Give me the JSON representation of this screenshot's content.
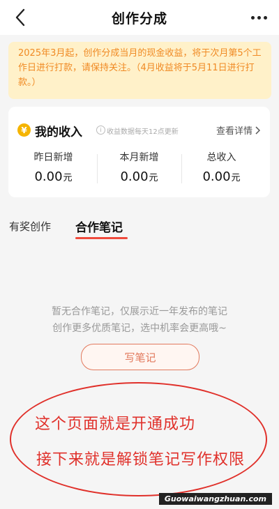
{
  "header": {
    "title": "创作分成",
    "back_icon": "chevron-left-icon",
    "more_icon": "more-horizontal-icon"
  },
  "notice": {
    "text": "2025年3月起，创作分成当月的现金收益，将于次月第5个工作日进行打款，请保持关注。（4月收益将于5月11日进行打款。）",
    "background": "#fff1c9",
    "color": "#f08a24"
  },
  "income": {
    "coin_symbol": "¥",
    "title": "我的收入",
    "info_icon": "info-icon",
    "subtitle": "收益数据每天12点更新",
    "detail_link": "查看详情",
    "stats": [
      {
        "label": "昨日新增",
        "value": "0.00",
        "unit": "元"
      },
      {
        "label": "本月新增",
        "value": "0.00",
        "unit": "元"
      },
      {
        "label": "总收入",
        "value": "0.00",
        "unit": "元"
      }
    ]
  },
  "tabs": {
    "items": [
      "有奖创作",
      "合作笔记"
    ],
    "active_index": 1,
    "accent": "#ef4a3c"
  },
  "empty_state": {
    "line1": "暂无合作笔记，仅展示近一年发布的笔记",
    "line2": "创作更多优质笔记，选中机率会更高哦~",
    "button_label": "写笔记"
  },
  "annotation": {
    "line1": "这个页面就是开通成功",
    "line2": "接下来就是解锁笔记写作权限",
    "color": "#e0302a"
  },
  "watermark": "Guowaiwangzhuan.com"
}
